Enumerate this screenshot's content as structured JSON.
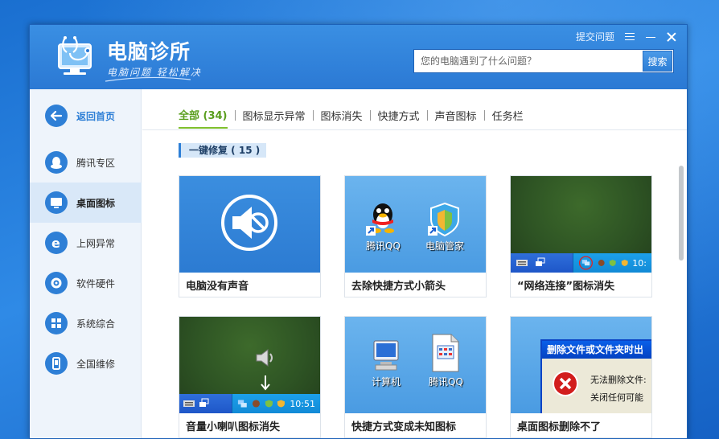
{
  "app": {
    "title": "电脑诊所",
    "slogan": "电脑问题  轻松解决",
    "report_link": "提交问题"
  },
  "search": {
    "placeholder": "您的电脑遇到了什么问题？",
    "button_label": "搜索"
  },
  "sidebar": {
    "items": [
      {
        "label": "返回首页",
        "icon": "back-arrow-icon"
      },
      {
        "label": "腾讯专区",
        "icon": "qq-penguin-icon"
      },
      {
        "label": "桌面图标",
        "icon": "monitor-icon"
      },
      {
        "label": "上网异常",
        "icon": "ie-browser-icon"
      },
      {
        "label": "软件硬件",
        "icon": "gear-icon"
      },
      {
        "label": "系统综合",
        "icon": "windows-logo-icon"
      },
      {
        "label": "全国维修",
        "icon": "phone-icon"
      }
    ]
  },
  "tabs": [
    {
      "label": "全部 (34)"
    },
    {
      "label": "图标显示异常"
    },
    {
      "label": "图标消失"
    },
    {
      "label": "快捷方式"
    },
    {
      "label": "声音图标"
    },
    {
      "label": "任务栏"
    }
  ],
  "section": {
    "label": "一键修复 ( 15 )"
  },
  "cards": [
    {
      "title": "电脑没有声音"
    },
    {
      "title": "去除快捷方式小箭头",
      "icons": [
        "腾讯QQ",
        "电脑管家"
      ]
    },
    {
      "title": "“网络连接”图标消失",
      "time": "10:"
    },
    {
      "title": "音量小喇叭图标消失",
      "time": "10:51"
    },
    {
      "title": "快捷方式变成未知图标",
      "icons": [
        "计算机",
        "腾讯QQ"
      ]
    },
    {
      "title": "桌面图标删除不了",
      "dialog_title": "删除文件或文件夹时出",
      "dialog_lines": [
        "无法删除文件:",
        "关闭任何可能"
      ]
    }
  ],
  "colors": {
    "header_blue": "#2b79d4",
    "accent_green": "#5a9e1e",
    "sidebar_bg": "#eef4fb",
    "brand_blue": "#2e7fd6"
  }
}
